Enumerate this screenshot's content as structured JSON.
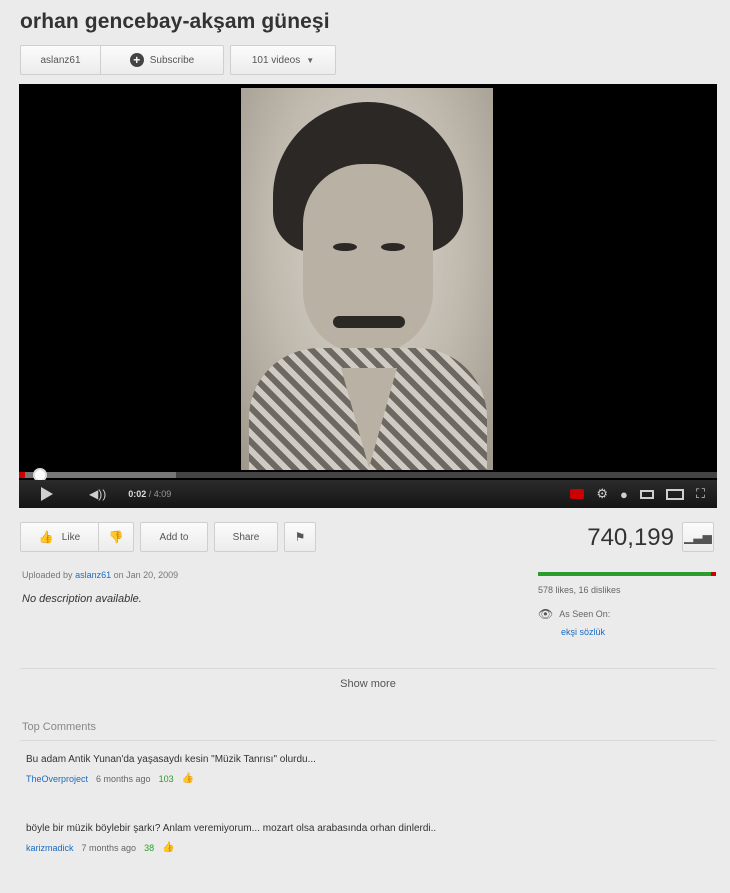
{
  "video": {
    "title": "orhan gencebay-akşam güneşi",
    "views": "740,199"
  },
  "channel": {
    "name": "aslanz61",
    "subscribe_label": "Subscribe",
    "videos_label": "101 videos"
  },
  "player": {
    "current_time": "0:02",
    "duration": "/ 4:09",
    "played_fraction": 0.008,
    "loaded_fraction": 0.225
  },
  "actions": {
    "like_label": "Like",
    "add_to_label": "Add to",
    "share_label": "Share"
  },
  "details": {
    "uploaded_prefix": "Uploaded by",
    "uploader": "aslanz61",
    "uploaded_date": "on Jan 20, 2009",
    "description": "No description available.",
    "likes_text": "578 likes, 16 dislikes",
    "like_ratio": 0.97,
    "seen_on_label": "As Seen On:",
    "seen_on_link": "ekşi sözlük",
    "show_more_label": "Show more"
  },
  "comments": {
    "heading": "Top Comments",
    "items": [
      {
        "text": "Bu adam Antik Yunan'da yaşasaydı kesin \"Müzik Tanrısı\" olurdu...",
        "author": "TheOverproject",
        "age": "6 months ago",
        "votes": "103"
      },
      {
        "text": "böyle bir müzik böylebir şarkı? Anlam veremiyorum... mozart olsa arabasında orhan dinlerdi..",
        "author": "karizmadick",
        "age": "7 months ago",
        "votes": "38"
      }
    ]
  },
  "colors": {
    "link": "#1a6cc2",
    "like_green": "#2c9d2c",
    "dislike_red": "#cc0000"
  },
  "icons": [
    "plus-icon",
    "chevron-down-icon",
    "play-icon",
    "volume-icon",
    "captions-icon",
    "gear-icon",
    "annotations-icon",
    "small-player-icon",
    "large-player-icon",
    "fullscreen-icon",
    "thumbs-up-icon",
    "thumbs-down-icon",
    "flag-icon",
    "stats-icon",
    "eye-icon",
    "thumbs-up-vote-icon"
  ]
}
